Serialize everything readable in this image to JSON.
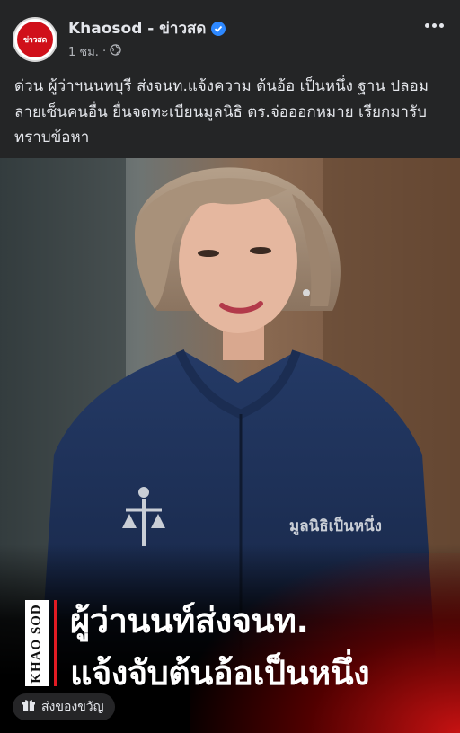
{
  "post": {
    "page_name": "Khaosod - ข่าวสด",
    "avatar_text": "ข่าวสด",
    "time": "1 ชม.",
    "separator": "·",
    "caption": "ด่วน ผู้ว่าฯนนทบุรี ส่งจนท.แจ้งความ ต้นอ้อ เป็นหนึ่ง ฐาน ปลอมลายเซ็นคนอื่น ยื่นจดทะเบียนมูลนิธิ ตร.จ่อออกหมาย เรียกมารับทราบข้อหา"
  },
  "image": {
    "jacket_logo_text": "มูลนิธิเป็นหนึ่ง",
    "brand_text": "KHAO SOD",
    "headline_line1": "ผู้ว่านนท์ส่งจนท.",
    "headline_line2": "แจ้งจับต้นอ้อเป็นหนึ่ง"
  },
  "actions": {
    "gift_label": "ส่งของขวัญ"
  },
  "colors": {
    "background": "#242526",
    "verified_badge": "#2d88ff",
    "brand_red": "#e21b23"
  }
}
